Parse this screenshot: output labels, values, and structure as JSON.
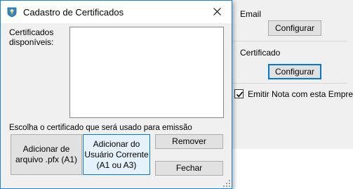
{
  "background": {
    "email_label": "Email",
    "email_button": "Configurar",
    "certificado_label": "Certificado",
    "certificado_button": "Configurar",
    "emitir_label": "Emitir Nota com esta Empresa",
    "emitir_checked": true
  },
  "dialog": {
    "title": "Cadastro de Certificados",
    "available_label_line1": "Certificados",
    "available_label_line2": "disponíveis:",
    "choose_label": "Escolha o certificado que será usado para emissão",
    "buttons": {
      "add_file_line1": "Adicionar de",
      "add_file_line2": "arquivo .pfx (A1)",
      "add_user_line1": "Adicionar do",
      "add_user_line2": "Usuário Corrente",
      "add_user_line3": "(A1 ou A3)",
      "remove": "Remover",
      "close": "Fechar"
    }
  },
  "colors": {
    "accent": "#0078d7",
    "window_bg": "#f0f0f0",
    "button_bg": "#e1e1e1"
  }
}
